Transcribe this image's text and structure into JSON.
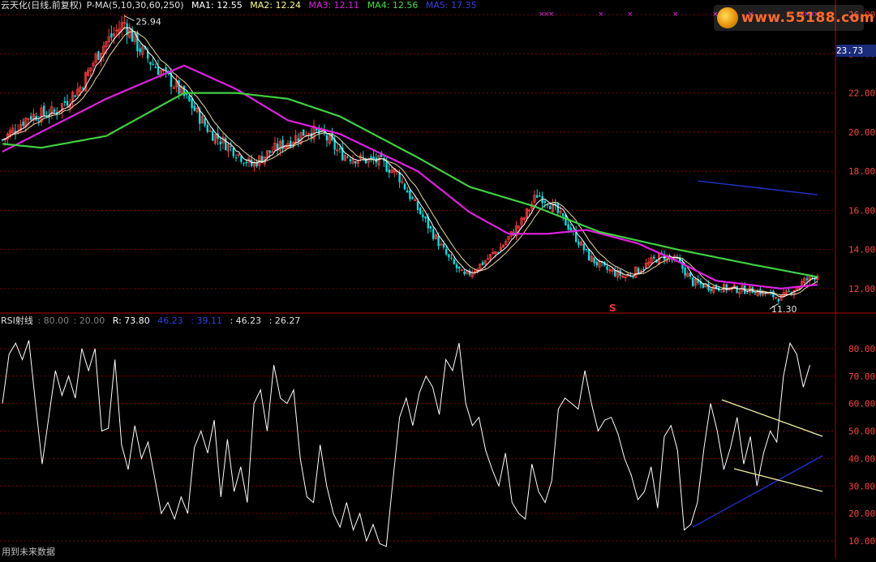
{
  "price_header": {
    "title": "云天化(日线,前复权)",
    "indicator": "P-MA(5,10,30,60,250)",
    "ma1": "MA1: 12.55",
    "ma2": "MA2: 12.24",
    "ma3": "MA3: 12.11",
    "ma4": "MA4: 12.56",
    "ma5": "MA5: 17.35"
  },
  "rsi_header": {
    "title": "RSI射线",
    "p1": ": 80.00",
    "p2": ": 20.00",
    "r": "R: 73.80",
    "v1": "46.23",
    "v2": ": 39.11",
    "v3": ": 46.23",
    "v4": ": 26.27"
  },
  "watermark": {
    "site": "www.55188.com"
  },
  "current_price_label": "23.73",
  "footer_text": "用到未来数据",
  "signal_marker": "S",
  "colors": {
    "bg": "#000000",
    "axis": "#b00000",
    "up": "#ff3b3b",
    "down": "#00e0e0",
    "ma1": "#ffffff",
    "ma2": "#e8d8a0",
    "ma3": "#e020e0",
    "ma4": "#40d040",
    "ma5": "#2030c0",
    "rsi": "#ffffff",
    "trend_up": "#2030d0",
    "channel": "#f0f0a0"
  },
  "chart_data": [
    {
      "type": "candlestick",
      "title": "云天化(日线,前复权)",
      "ylim": [
        11.0,
        26.5
      ],
      "y_ticks": [
        "26.00",
        "24.00",
        "22.00",
        "20.00",
        "18.00",
        "16.00",
        "14.00",
        "12.00"
      ],
      "annotations": [
        {
          "text": "25.94",
          "bar_index": 47,
          "price": 25.94
        },
        {
          "text": "11.30",
          "bar_index": 300,
          "price": 11.3
        }
      ],
      "anchor_closes": [
        [
          0,
          19.6
        ],
        [
          10,
          20.8
        ],
        [
          20,
          21.0
        ],
        [
          30,
          22.3
        ],
        [
          38,
          24.3
        ],
        [
          47,
          25.6
        ],
        [
          52,
          24.4
        ],
        [
          57,
          23.6
        ],
        [
          65,
          22.6
        ],
        [
          72,
          21.5
        ],
        [
          80,
          20.0
        ],
        [
          88,
          19.2
        ],
        [
          96,
          18.3
        ],
        [
          102,
          18.9
        ],
        [
          110,
          19.5
        ],
        [
          118,
          20.1
        ],
        [
          124,
          19.8
        ],
        [
          130,
          18.9
        ],
        [
          138,
          18.6
        ],
        [
          145,
          18.5
        ],
        [
          152,
          17.9
        ],
        [
          158,
          16.5
        ],
        [
          164,
          15.2
        ],
        [
          172,
          13.5
        ],
        [
          178,
          12.6
        ],
        [
          184,
          13.2
        ],
        [
          192,
          14.1
        ],
        [
          200,
          15.4
        ],
        [
          206,
          16.8
        ],
        [
          210,
          16.5
        ],
        [
          218,
          15.2
        ],
        [
          226,
          13.6
        ],
        [
          232,
          13.0
        ],
        [
          240,
          12.6
        ],
        [
          248,
          13.2
        ],
        [
          254,
          13.7
        ],
        [
          260,
          13.4
        ],
        [
          266,
          12.3
        ],
        [
          272,
          12.1
        ],
        [
          280,
          12.0
        ],
        [
          290,
          11.9
        ],
        [
          300,
          11.5
        ],
        [
          309,
          12.4
        ],
        [
          314,
          12.7
        ]
      ],
      "ma_anchors": {
        "MA3": [
          [
            0,
            19.0
          ],
          [
            40,
            21.7
          ],
          [
            70,
            23.4
          ],
          [
            90,
            22.2
          ],
          [
            110,
            20.6
          ],
          [
            130,
            19.9
          ],
          [
            160,
            18.0
          ],
          [
            180,
            15.9
          ],
          [
            195,
            14.8
          ],
          [
            210,
            14.8
          ],
          [
            225,
            15.0
          ],
          [
            245,
            14.3
          ],
          [
            260,
            13.4
          ],
          [
            275,
            12.4
          ],
          [
            300,
            12.0
          ],
          [
            314,
            12.2
          ]
        ],
        "MA4": [
          [
            0,
            19.4
          ],
          [
            15,
            19.2
          ],
          [
            40,
            19.8
          ],
          [
            70,
            22.0
          ],
          [
            90,
            22.0
          ],
          [
            110,
            21.7
          ],
          [
            130,
            20.8
          ],
          [
            160,
            18.7
          ],
          [
            180,
            17.2
          ],
          [
            205,
            16.2
          ],
          [
            230,
            14.9
          ],
          [
            260,
            14.0
          ],
          [
            290,
            13.2
          ],
          [
            314,
            12.6
          ]
        ],
        "MA5": [
          [
            268,
            17.5
          ],
          [
            314,
            16.8
          ]
        ]
      }
    },
    {
      "type": "line",
      "title": "RSI射线",
      "ylim": [
        5,
        90
      ],
      "y_ticks": [
        "80.00",
        "70.00",
        "60.00",
        "50.00",
        "40.00",
        "30.00",
        "20.00",
        "10.00"
      ],
      "series": [
        {
          "values": [
            60,
            78,
            82,
            76,
            83,
            60,
            38,
            55,
            72,
            63,
            70,
            62,
            80,
            72,
            80,
            50,
            51,
            76,
            45,
            36,
            52,
            40,
            46,
            33,
            20,
            24,
            18,
            26,
            20,
            44,
            50,
            42,
            54,
            26,
            47,
            28,
            37,
            24,
            60,
            65,
            50,
            74,
            62,
            60,
            65,
            40,
            26,
            24,
            45,
            30,
            20,
            15,
            24,
            14,
            20,
            10,
            16,
            9,
            8,
            32,
            55,
            62,
            52,
            64,
            70,
            66,
            56,
            76,
            72,
            82,
            60,
            52,
            55,
            43,
            36,
            30,
            42,
            24,
            20,
            18,
            38,
            28,
            24,
            32,
            58,
            62,
            60,
            58,
            72,
            60,
            50,
            54,
            55,
            49,
            40,
            34,
            25,
            28,
            37,
            22,
            48,
            52,
            43,
            14,
            16,
            24,
            44,
            60,
            50,
            36,
            44,
            55,
            38,
            48,
            30,
            42,
            50,
            46,
            70,
            82,
            78,
            66,
            74
          ],
          "step_every_bars": 2.55
        }
      ],
      "trendlines": [
        {
          "name": "support",
          "from": [
            854,
            650
          ],
          "to": [
            1014,
            562
          ]
        },
        {
          "name": "channel-top",
          "from": [
            890,
            493
          ],
          "to": [
            1014,
            538
          ]
        },
        {
          "name": "channel-bottom",
          "from": [
            905,
            578
          ],
          "to": [
            1014,
            606
          ]
        }
      ]
    }
  ]
}
